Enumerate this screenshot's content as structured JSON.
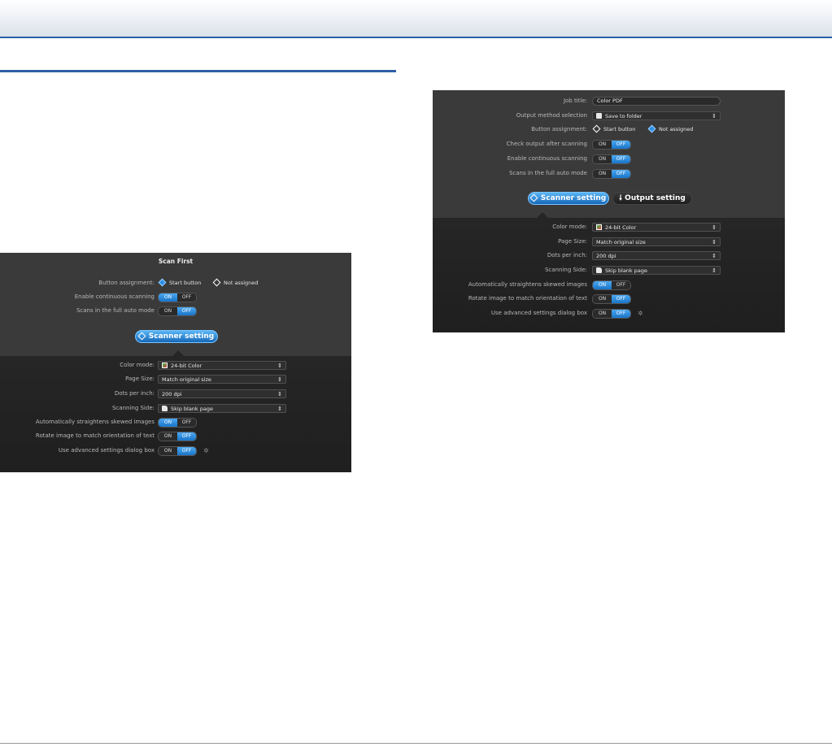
{
  "left_panel": {
    "title": "Scan First",
    "button_assignment": {
      "label": "Button assignment:",
      "start": "Start button",
      "not_assigned": "Not assigned",
      "selected": "start"
    },
    "enable_continuous": {
      "label": "Enable continuous scanning",
      "on": "ON",
      "off": "OFF",
      "value": "ON"
    },
    "full_auto": {
      "label": "Scans in the full auto mode",
      "on": "ON",
      "off": "OFF",
      "value": "OFF"
    },
    "scanner_setting_button": "Scanner setting",
    "color_mode": {
      "label": "Color mode:",
      "value": "24-bit Color"
    },
    "page_size": {
      "label": "Page Size:",
      "value": "Match original size"
    },
    "dpi": {
      "label": "Dots per inch:",
      "value": "200 dpi"
    },
    "scanning_side": {
      "label": "Scanning Side:",
      "value": "Skip blank page"
    },
    "straighten": {
      "label": "Automatically straightens skewed images",
      "on": "ON",
      "off": "OFF",
      "value": "ON"
    },
    "rotate": {
      "label": "Rotate image to match orientation of text",
      "on": "ON",
      "off": "OFF",
      "value": "OFF"
    },
    "advanced": {
      "label": "Use advanced settings dialog box",
      "on": "ON",
      "off": "OFF",
      "value": "OFF"
    }
  },
  "right_panel": {
    "job_title": {
      "label": "Job title:",
      "value": "Color PDF"
    },
    "output_method": {
      "label": "Output method selection",
      "value": "Save to folder"
    },
    "button_assignment": {
      "label": "Button assignment:",
      "start": "Start button",
      "not_assigned": "Not assigned",
      "selected": "not_assigned"
    },
    "check_output": {
      "label": "Check output after scanning",
      "on": "ON",
      "off": "OFF",
      "value": "OFF"
    },
    "enable_continuous": {
      "label": "Enable continuous scanning",
      "on": "ON",
      "off": "OFF",
      "value": "OFF"
    },
    "full_auto": {
      "label": "Scans in the full auto mode",
      "on": "ON",
      "off": "OFF",
      "value": "OFF"
    },
    "scanner_setting_button": "Scanner setting",
    "output_setting_button": "Output setting",
    "color_mode": {
      "label": "Color mode:",
      "value": "24-bit Color"
    },
    "page_size": {
      "label": "Page Size:",
      "value": "Match original size"
    },
    "dpi": {
      "label": "Dots per inch:",
      "value": "200 dpi"
    },
    "scanning_side": {
      "label": "Scanning Side:",
      "value": "Skip blank page"
    },
    "straighten": {
      "label": "Automatically straightens skewed images",
      "on": "ON",
      "off": "OFF",
      "value": "ON"
    },
    "rotate": {
      "label": "Rotate image to match orientation of text",
      "on": "ON",
      "off": "OFF",
      "value": "OFF"
    },
    "advanced": {
      "label": "Use advanced settings dialog box",
      "on": "ON",
      "off": "OFF",
      "value": "OFF"
    }
  },
  "colors": {
    "accent": "#2a5fa8",
    "panel_bg": "#3a3a3a",
    "toggle_active": "#1a74c8"
  }
}
